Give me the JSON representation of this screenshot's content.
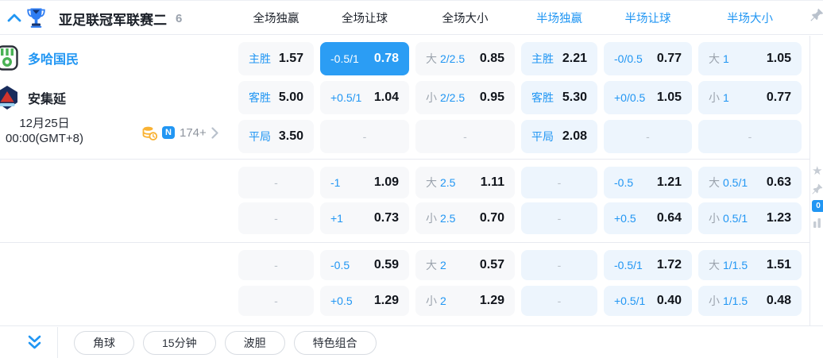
{
  "accent_color": "#2196f3",
  "highlight_cell_color": "#2b9df4",
  "empty_placeholder": "-",
  "header": {
    "league_title": "亚足联冠军联赛二",
    "match_count": "6",
    "columns": [
      {
        "label": "全场独赢",
        "blue": false
      },
      {
        "label": "全场让球",
        "blue": false
      },
      {
        "label": "全场大小",
        "blue": false
      },
      {
        "label": "半场独赢",
        "blue": true
      },
      {
        "label": "半场让球",
        "blue": true
      },
      {
        "label": "半场大小",
        "blue": true
      }
    ]
  },
  "match": {
    "home_team": "多哈国民",
    "away_team": "安集延",
    "date": "12月25日",
    "time": "00:00(GMT+8)",
    "n_badge": "N",
    "more_markets": "174+"
  },
  "odds_sections": [
    {
      "rows": [
        [
          {
            "label": "主胜",
            "value": "1.57"
          },
          {
            "label": "-0.5/1",
            "value": "0.78",
            "highlight": true
          },
          {
            "prefix": "大",
            "line": "2/2.5",
            "value": "0.85"
          },
          {
            "label": "主胜",
            "value": "2.21"
          },
          {
            "label": "-0/0.5",
            "value": "0.77"
          },
          {
            "prefix": "大",
            "line": "1",
            "value": "1.05"
          }
        ],
        [
          {
            "label": "客胜",
            "value": "5.00"
          },
          {
            "label": "+0.5/1",
            "value": "1.04"
          },
          {
            "prefix": "小",
            "line": "2/2.5",
            "value": "0.95"
          },
          {
            "label": "客胜",
            "value": "5.30"
          },
          {
            "label": "+0/0.5",
            "value": "1.05"
          },
          {
            "prefix": "小",
            "line": "1",
            "value": "0.77"
          }
        ],
        [
          {
            "label": "平局",
            "value": "3.50"
          },
          {
            "dash": true
          },
          {
            "dash": true
          },
          {
            "label": "平局",
            "value": "2.08"
          },
          {
            "dash": true
          },
          {
            "dash": true
          }
        ]
      ]
    },
    {
      "rows": [
        [
          {
            "dash": true
          },
          {
            "label": "-1",
            "value": "1.09"
          },
          {
            "prefix": "大",
            "line": "2.5",
            "value": "1.11"
          },
          {
            "dash": true
          },
          {
            "label": "-0.5",
            "value": "1.21"
          },
          {
            "prefix": "大",
            "line": "0.5/1",
            "value": "0.63"
          }
        ],
        [
          {
            "dash": true
          },
          {
            "label": "+1",
            "value": "0.73"
          },
          {
            "prefix": "小",
            "line": "2.5",
            "value": "0.70"
          },
          {
            "dash": true
          },
          {
            "label": "+0.5",
            "value": "0.64"
          },
          {
            "prefix": "小",
            "line": "0.5/1",
            "value": "1.23"
          }
        ]
      ]
    },
    {
      "rows": [
        [
          {
            "dash": true
          },
          {
            "label": "-0.5",
            "value": "0.59"
          },
          {
            "prefix": "大",
            "line": "2",
            "value": "0.57"
          },
          {
            "dash": true
          },
          {
            "label": "-0.5/1",
            "value": "1.72"
          },
          {
            "prefix": "大",
            "line": "1/1.5",
            "value": "1.51"
          }
        ],
        [
          {
            "dash": true
          },
          {
            "label": "+0.5",
            "value": "1.29"
          },
          {
            "prefix": "小",
            "line": "2",
            "value": "1.29"
          },
          {
            "dash": true
          },
          {
            "label": "+0.5/1",
            "value": "0.40"
          },
          {
            "prefix": "小",
            "line": "1/1.5",
            "value": "0.48"
          }
        ]
      ]
    }
  ],
  "right_rail": {
    "odds_count_badge": "0"
  },
  "footer": {
    "buttons": [
      "角球",
      "15分钟",
      "波胆",
      "特色组合"
    ]
  }
}
